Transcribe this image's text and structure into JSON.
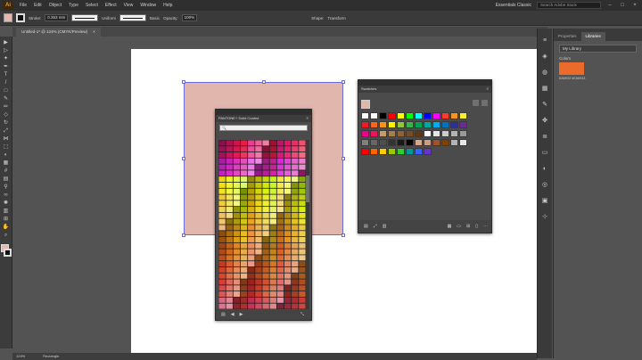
{
  "menu": {
    "logo": "Ai",
    "items": [
      "File",
      "Edit",
      "Object",
      "Type",
      "Select",
      "Effect",
      "View",
      "Window",
      "Help"
    ],
    "workspace": "Essentials Classic",
    "search_placeholder": "Search Adobe Stock"
  },
  "control_bar": {
    "stroke_label": "Stroke:",
    "stroke_weight": "0.353 mm",
    "profile": "Uniform",
    "brush": "Basic",
    "opacity_label": "Opacity:",
    "opacity_value": "100%",
    "shape_label": "Shape:",
    "transform_label": "Transform"
  },
  "document": {
    "tab_title": "Untitled-1* @ 124% (CMYK/Preview)",
    "tab_close": "×"
  },
  "pantone_panel": {
    "title": "PANTONE+ Solid Coated",
    "find_value": "🔍"
  },
  "swatches_panel": {
    "title": "Swatches"
  },
  "libraries": {
    "tabs": [
      "Properties",
      "Libraries"
    ],
    "library_name": "My Library",
    "section": "Colors",
    "color_name": "E86933 #E86933",
    "color_hex": "#ec6a2a"
  },
  "status": {
    "zoom": "124%",
    "tool": "Rectangle"
  },
  "colors": {
    "rect_fill": "#e0b6ad",
    "accent": "#ec6a2a"
  }
}
